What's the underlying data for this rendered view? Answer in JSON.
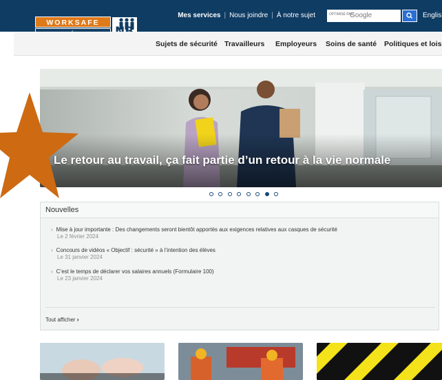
{
  "logo": {
    "line1": "WORKSAFE",
    "line2": "TRAVAIL SÉCURITAIRE",
    "badge": "NB"
  },
  "toplinks": {
    "services": "Mes services",
    "join": "Nous joindre",
    "about": "À notre sujet",
    "english": "English"
  },
  "search": {
    "powered": "OPTIMISÉ PAR",
    "google": "Google"
  },
  "nav": [
    "Sujets de sécurité",
    "Travailleurs",
    "Employeurs",
    "Soins de santé",
    "Politiques et lois"
  ],
  "hero": {
    "title": "Le retour au travail, ça fait partie d’un retour à la vie normale",
    "slides": 8,
    "active_slide": 6
  },
  "news": {
    "heading": "Nouvelles",
    "items": [
      {
        "title": "Mise à jour importante : Des changements seront bientôt apportés aux exigences relatives aux casques de sécurité",
        "date": "Le 2 février 2024"
      },
      {
        "title": "Concours de vidéos « Objectif : sécurité » à l’intention des élèves",
        "date": "Le 31 janvier 2024"
      },
      {
        "title": "C’est le temps de déclarer vos salaires annuels (Formulaire 100)",
        "date": "Le 23 janvier 2024"
      }
    ],
    "view_all": "Tout afficher"
  },
  "colors": {
    "brand_navy": "#0f3c63",
    "brand_orange": "#df7a1a",
    "star": "#cd6a12",
    "dot": "#17467a"
  }
}
